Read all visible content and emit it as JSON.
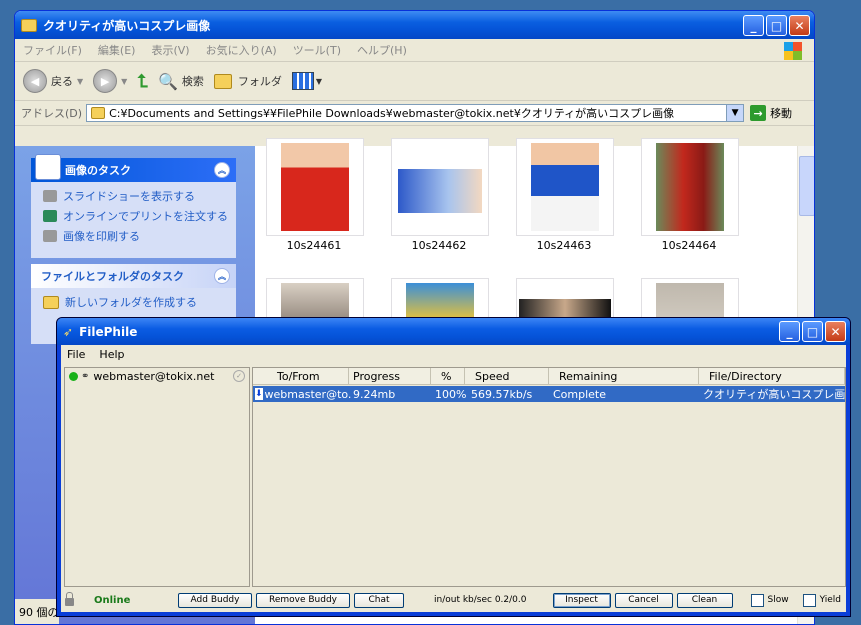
{
  "explorer": {
    "title": "クオリティが高いコスプレ画像",
    "menu": [
      "ファイル(F)",
      "編集(E)",
      "表示(V)",
      "お気に入り(A)",
      "ツール(T)",
      "ヘルプ(H)"
    ],
    "toolbar": {
      "back": "戻る",
      "search": "検索",
      "folders": "フォルダ"
    },
    "address_label": "アドレス(D)",
    "address_value": "C:¥Documents and Settings¥¥FilePhile Downloads¥webmaster@tokix.net¥クオリティが高いコスプレ画像",
    "go_label": "移動",
    "task_image_header": "画像のタスク",
    "task_image_items": [
      "スライドショーを表示する",
      "オンラインでプリントを注文する",
      "画像を印刷する"
    ],
    "task_file_header": "ファイルとフォルダのタスク",
    "task_file_items": [
      "新しいフォルダを作成する"
    ],
    "thumbnails": [
      "10s24461",
      "10s24462",
      "10s24463",
      "10s24464"
    ],
    "status_text": "90 個の"
  },
  "filephile": {
    "title": "FilePhile",
    "menu": [
      "File",
      "Help"
    ],
    "buddy": "webmaster@tokix.net",
    "columns": [
      "To/From",
      "Progress",
      "%",
      "Speed",
      "Remaining",
      "File/Directory"
    ],
    "transfer": {
      "to_from": "webmaster@to...",
      "progress": "9.24mb",
      "percent": "100%",
      "speed": "569.57kb/s",
      "remaining": "Complete",
      "file": "クオリティが高いコスプレ画像"
    },
    "status": "Online",
    "buttons": {
      "add": "Add Buddy",
      "remove": "Remove Buddy",
      "chat": "Chat",
      "inspect": "Inspect",
      "cancel": "Cancel",
      "clean": "Clean"
    },
    "speed_readout": "in/out kb/sec 0.2/0.0",
    "slow_label": "Slow",
    "yield_label": "Yield"
  },
  "colors": {
    "xp_blue": "#0a5fe0",
    "selection": "#316ac5",
    "online_green": "#19b119"
  }
}
